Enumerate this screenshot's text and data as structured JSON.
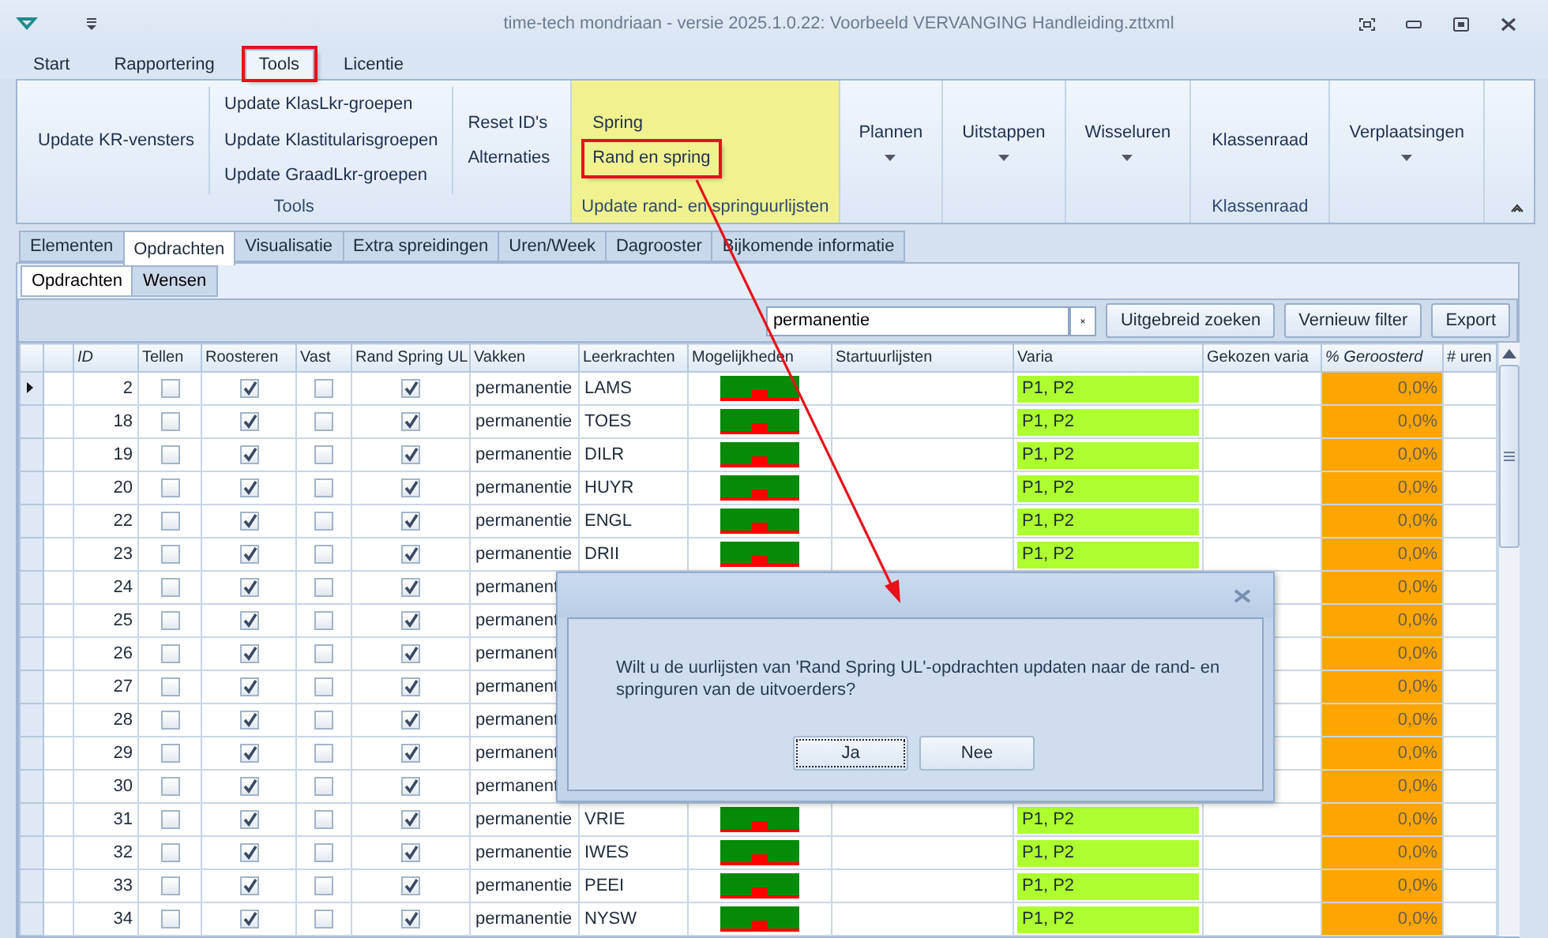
{
  "window": {
    "title": "time-tech mondriaan - versie 2025.1.0.22: Voorbeeld VERVANGING Handleiding.zttxml"
  },
  "menu_tabs": [
    {
      "label": "Start",
      "selected": false,
      "highlighted": false
    },
    {
      "label": "Rapportering",
      "selected": false,
      "highlighted": false
    },
    {
      "label": "Tools",
      "selected": true,
      "highlighted": true
    },
    {
      "label": "Licentie",
      "selected": false,
      "highlighted": false
    }
  ],
  "ribbon": {
    "groups": [
      {
        "kind": "buttons",
        "label": "Tools",
        "active": false,
        "columns": [
          [
            {
              "label": "Update KR-vensters",
              "highlighted": false
            }
          ],
          [
            {
              "label": "Update KlasLkr-groepen",
              "highlighted": false
            },
            {
              "label": "Update Klastitularisgroepen",
              "highlighted": false
            },
            {
              "label": "Update GraadLkr-groepen",
              "highlighted": false
            }
          ],
          [
            {
              "label": "Reset ID's",
              "highlighted": false
            },
            {
              "label": "Alternaties",
              "highlighted": false
            }
          ]
        ]
      },
      {
        "kind": "buttons",
        "label": "Update rand- en springuurlijsten",
        "active": true,
        "columns": [
          [
            {
              "label": "Spring",
              "highlighted": false
            },
            {
              "label": "Rand en spring",
              "highlighted": true
            }
          ]
        ]
      },
      {
        "kind": "dropdown",
        "label": "Plannen"
      },
      {
        "kind": "dropdown",
        "label": "Uitstappen"
      },
      {
        "kind": "dropdown",
        "label": "Wisseluren"
      },
      {
        "kind": "buttons",
        "label": "Klassenraad",
        "active": false,
        "columns": [
          [
            {
              "label": "Klassenraad",
              "highlighted": false
            }
          ]
        ]
      },
      {
        "kind": "dropdown",
        "label": "Verplaatsingen"
      }
    ]
  },
  "doc_tabs": [
    {
      "label": "Elementen",
      "selected": false
    },
    {
      "label": "Opdrachten",
      "selected": true
    },
    {
      "label": "Visualisatie",
      "selected": false
    },
    {
      "label": "Extra spreidingen",
      "selected": false
    },
    {
      "label": "Uren/Week",
      "selected": false
    },
    {
      "label": "Dagrooster",
      "selected": false
    },
    {
      "label": "Bijkomende informatie",
      "selected": false
    }
  ],
  "sub_tabs": [
    {
      "label": "Opdrachten",
      "selected": true
    },
    {
      "label": "Wensen",
      "selected": false
    }
  ],
  "filter": {
    "value": "permanentie",
    "buttons": [
      "Uitgebreid zoeken",
      "Vernieuw filter",
      "Export"
    ]
  },
  "table": {
    "columns": [
      {
        "label": "ID",
        "italic": true
      },
      {
        "label": "Tellen",
        "italic": false
      },
      {
        "label": "Roosteren",
        "italic": false
      },
      {
        "label": "Vast",
        "italic": false
      },
      {
        "label": "Rand Spring UL",
        "italic": false
      },
      {
        "label": "Vakken",
        "italic": false
      },
      {
        "label": "Leerkrachten",
        "italic": false
      },
      {
        "label": "Mogelijkheden",
        "italic": false
      },
      {
        "label": "Startuurlijsten",
        "italic": false
      },
      {
        "label": "Varia",
        "italic": false
      },
      {
        "label": "Gekozen varia",
        "italic": false
      },
      {
        "label": "% Geroosterd",
        "italic": true
      },
      {
        "label": "# uren",
        "italic": false
      }
    ],
    "rows": [
      {
        "current": true,
        "id": "2",
        "tellen": false,
        "roosteren": true,
        "vast": false,
        "rand_spring_ul": true,
        "vakken": "permanentie",
        "leerkrachten": "LAMS",
        "varia": "P1, P2",
        "geroosterd": "0,0%"
      },
      {
        "current": false,
        "id": "18",
        "tellen": false,
        "roosteren": true,
        "vast": false,
        "rand_spring_ul": true,
        "vakken": "permanentie",
        "leerkrachten": "TOES",
        "varia": "P1, P2",
        "geroosterd": "0,0%"
      },
      {
        "current": false,
        "id": "19",
        "tellen": false,
        "roosteren": true,
        "vast": false,
        "rand_spring_ul": true,
        "vakken": "permanentie",
        "leerkrachten": "DILR",
        "varia": "P1, P2",
        "geroosterd": "0,0%"
      },
      {
        "current": false,
        "id": "20",
        "tellen": false,
        "roosteren": true,
        "vast": false,
        "rand_spring_ul": true,
        "vakken": "permanentie",
        "leerkrachten": "HUYR",
        "varia": "P1, P2",
        "geroosterd": "0,0%"
      },
      {
        "current": false,
        "id": "22",
        "tellen": false,
        "roosteren": true,
        "vast": false,
        "rand_spring_ul": true,
        "vakken": "permanentie",
        "leerkrachten": "ENGL",
        "varia": "P1, P2",
        "geroosterd": "0,0%"
      },
      {
        "current": false,
        "id": "23",
        "tellen": false,
        "roosteren": true,
        "vast": false,
        "rand_spring_ul": true,
        "vakken": "permanentie",
        "leerkrachten": "DRII",
        "varia": "P1, P2",
        "geroosterd": "0,0%"
      },
      {
        "current": false,
        "id": "24",
        "tellen": false,
        "roosteren": true,
        "vast": false,
        "rand_spring_ul": true,
        "vakken": "permanent",
        "geroosterd": "0,0%"
      },
      {
        "current": false,
        "id": "25",
        "tellen": false,
        "roosteren": true,
        "vast": false,
        "rand_spring_ul": true,
        "vakken": "permanent",
        "geroosterd": "0,0%"
      },
      {
        "current": false,
        "id": "26",
        "tellen": false,
        "roosteren": true,
        "vast": false,
        "rand_spring_ul": true,
        "vakken": "permanent",
        "geroosterd": "0,0%"
      },
      {
        "current": false,
        "id": "27",
        "tellen": false,
        "roosteren": true,
        "vast": false,
        "rand_spring_ul": true,
        "vakken": "permanent",
        "geroosterd": "0,0%"
      },
      {
        "current": false,
        "id": "28",
        "tellen": false,
        "roosteren": true,
        "vast": false,
        "rand_spring_ul": true,
        "vakken": "permanent",
        "geroosterd": "0,0%"
      },
      {
        "current": false,
        "id": "29",
        "tellen": false,
        "roosteren": true,
        "vast": false,
        "rand_spring_ul": true,
        "vakken": "permanent",
        "geroosterd": "0,0%"
      },
      {
        "current": false,
        "id": "30",
        "tellen": false,
        "roosteren": true,
        "vast": false,
        "rand_spring_ul": true,
        "vakken": "permanent",
        "geroosterd": "0,0%"
      },
      {
        "current": false,
        "id": "31",
        "tellen": false,
        "roosteren": true,
        "vast": false,
        "rand_spring_ul": true,
        "vakken": "permanentie",
        "leerkrachten": "VRIE",
        "varia": "P1, P2",
        "geroosterd": "0,0%"
      },
      {
        "current": false,
        "id": "32",
        "tellen": false,
        "roosteren": true,
        "vast": false,
        "rand_spring_ul": true,
        "vakken": "permanentie",
        "leerkrachten": "IWES",
        "varia": "P1, P2",
        "geroosterd": "0,0%"
      },
      {
        "current": false,
        "id": "33",
        "tellen": false,
        "roosteren": true,
        "vast": false,
        "rand_spring_ul": true,
        "vakken": "permanentie",
        "leerkrachten": "PEEI",
        "varia": "P1, P2",
        "geroosterd": "0,0%"
      },
      {
        "current": false,
        "id": "34",
        "tellen": false,
        "roosteren": true,
        "vast": false,
        "rand_spring_ul": true,
        "vakken": "permanentie",
        "leerkrachten": "NYSW",
        "varia": "P1, P2",
        "geroosterd": "0,0%"
      }
    ]
  },
  "dialog": {
    "message": "Wilt u de uurlijsten van 'Rand Spring UL'-opdrachten updaten naar de rand- en springuren van de uitvoerders?",
    "buttons": [
      {
        "label": "Ja",
        "focused": true
      },
      {
        "label": "Nee",
        "focused": false
      }
    ]
  }
}
